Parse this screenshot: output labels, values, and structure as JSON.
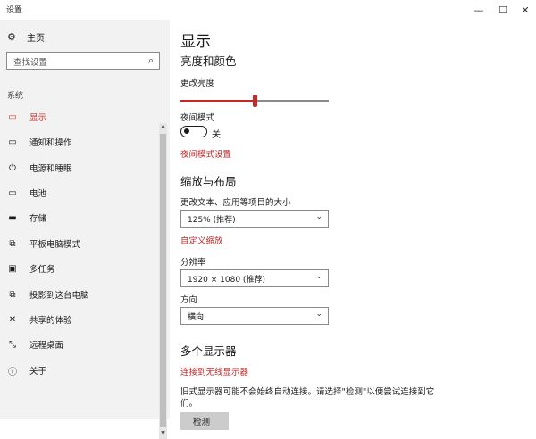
{
  "window": {
    "title": "设置",
    "controls": {
      "minimize": "—",
      "maximize": "☐",
      "close": "✕"
    }
  },
  "sidebar": {
    "home_label": "主页",
    "home_icon": "gear-icon",
    "search_placeholder": "查找设置",
    "section_label": "系统",
    "items": [
      {
        "label": "显示",
        "icon": "display-icon",
        "active": true
      },
      {
        "label": "通知和操作",
        "icon": "notification-icon"
      },
      {
        "label": "电源和睡眠",
        "icon": "power-icon"
      },
      {
        "label": "电池",
        "icon": "battery-icon"
      },
      {
        "label": "存储",
        "icon": "storage-icon"
      },
      {
        "label": "平板电脑模式",
        "icon": "tablet-icon"
      },
      {
        "label": "多任务",
        "icon": "multitask-icon"
      },
      {
        "label": "投影到这台电脑",
        "icon": "project-icon"
      },
      {
        "label": "共享的体验",
        "icon": "shared-icon"
      },
      {
        "label": "远程桌面",
        "icon": "remote-icon"
      },
      {
        "label": "关于",
        "icon": "info-icon"
      }
    ]
  },
  "main": {
    "page_title": "显示",
    "brightness_section": {
      "heading": "亮度和颜色",
      "brightness_label": "更改亮度",
      "brightness_value": 0.5,
      "night_mode_label": "夜间模式",
      "night_mode_state": "关",
      "night_mode_link": "夜间模式设置"
    },
    "scale_section": {
      "heading": "缩放与布局",
      "scale_label": "更改文本、应用等项目的大小",
      "scale_value": "125% (推荐)",
      "custom_scale_link": "自定义缩放",
      "resolution_label": "分辨率",
      "resolution_value": "1920 × 1080 (推荐)",
      "orientation_label": "方向",
      "orientation_value": "横向"
    },
    "multi_display_section": {
      "heading": "多个显示器",
      "wireless_link": "连接到无线显示器",
      "description": "旧式显示器可能不会始终自动连接。请选择\"检测\"以便尝试连接到它们。",
      "detect_button": "检测"
    }
  },
  "colors": {
    "accent": "#c62828",
    "sidebar_bg": "#f2f2f2"
  }
}
